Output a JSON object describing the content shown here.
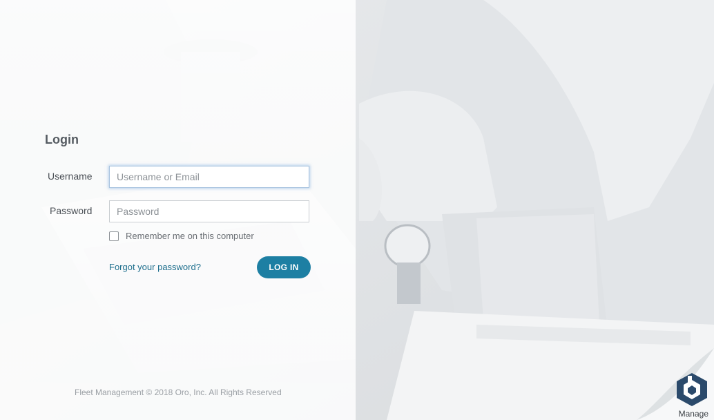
{
  "login": {
    "title": "Login",
    "username_label": "Username",
    "username_placeholder": "Username or Email",
    "password_label": "Password",
    "password_placeholder": "Password",
    "remember_label": "Remember me on this computer",
    "remember_checked": false,
    "forgot_link": "Forgot your password?",
    "login_button": "LOG IN"
  },
  "footer": {
    "copyright": "Fleet Management © 2018 Oro, Inc. All Rights Reserved"
  },
  "manage_widget": {
    "label": "Manage",
    "icon": "oro-logo-icon"
  },
  "colors": {
    "accent": "#1d7fa3",
    "link": "#1d6e8d",
    "logo": "#2b4a6b"
  }
}
